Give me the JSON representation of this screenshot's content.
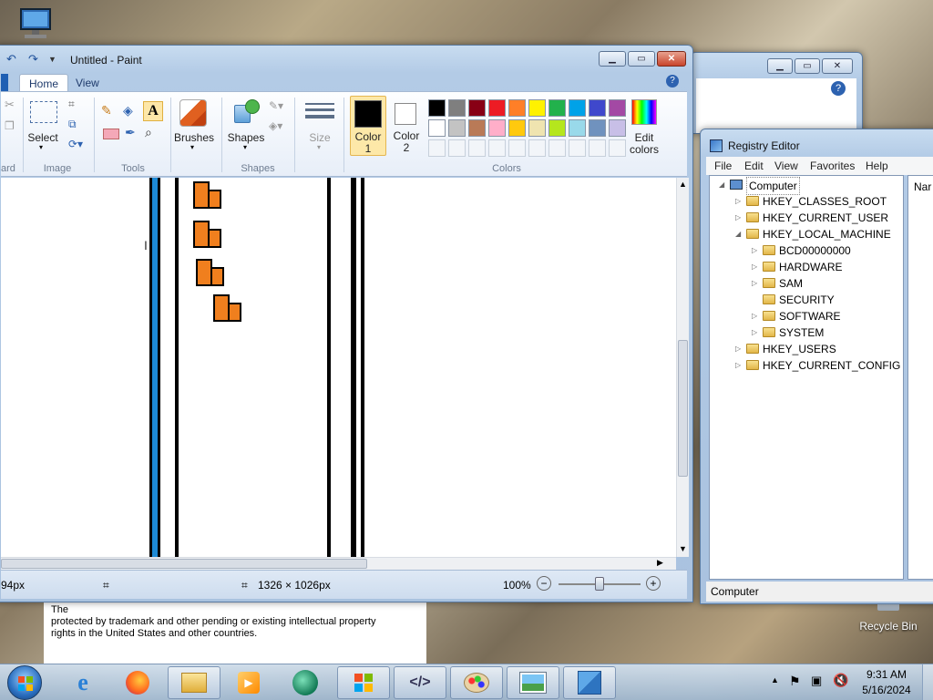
{
  "desktop": {
    "recycle_bin": "Recycle Bin"
  },
  "paint": {
    "title": "Untitled - Paint",
    "tabs": {
      "home": "Home",
      "view": "View"
    },
    "groups": {
      "clipboard_partial": "ard",
      "image": "Image",
      "tools": "Tools",
      "shapes": "Shapes",
      "colors": "Colors"
    },
    "buttons": {
      "select": "Select",
      "brushes": "Brushes",
      "shapes": "Shapes",
      "size": "Size",
      "color1_a": "Color",
      "color1_b": "1",
      "color2_a": "Color",
      "color2_b": "2",
      "edit_colors_a": "Edit",
      "edit_colors_b": "colors"
    },
    "palette_row1": [
      "#000000",
      "#7f7f7f",
      "#880015",
      "#ed1c24",
      "#ff7f27",
      "#fff200",
      "#22b14c",
      "#00a2e8",
      "#3f48cc",
      "#a349a4"
    ],
    "palette_row2": [
      "#ffffff",
      "#c3c3c3",
      "#b97a57",
      "#ffaec9",
      "#ffc90e",
      "#efe4b0",
      "#b5e61d",
      "#99d9ea",
      "#7092be",
      "#c8bfe7"
    ],
    "status": {
      "position": "94px",
      "size": "1326 × 1026px",
      "zoom": "100%"
    },
    "zoom_level": 0.5
  },
  "registry": {
    "title": "Registry Editor",
    "menu": [
      "File",
      "Edit",
      "View",
      "Favorites",
      "Help"
    ],
    "tree": {
      "root": "Computer",
      "hkcr": "HKEY_CLASSES_ROOT",
      "hkcu": "HKEY_CURRENT_USER",
      "hklm": "HKEY_LOCAL_MACHINE",
      "bcd": "BCD00000000",
      "hardware": "HARDWARE",
      "sam": "SAM",
      "security": "SECURITY",
      "software": "SOFTWARE",
      "system": "SYSTEM",
      "hku": "HKEY_USERS",
      "hkcc": "HKEY_CURRENT_CONFIG"
    },
    "right_header": "Nar",
    "status": "Computer"
  },
  "about": {
    "line1": "The",
    "line2": "protected by trademark and other pending or existing intellectual property",
    "line3": "rights in the United States and other countries."
  },
  "taskbar": {
    "time": "9:31 AM",
    "date": "5/16/2024"
  }
}
